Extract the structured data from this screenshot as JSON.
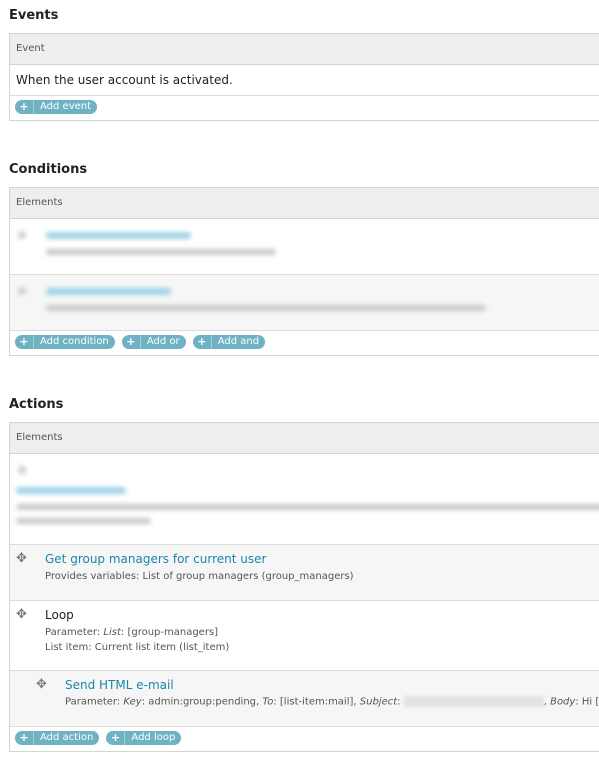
{
  "events": {
    "title": "Events",
    "column_header": "Event",
    "rows": [
      {
        "text": "When the user account is activated."
      }
    ],
    "buttons": [
      {
        "icon": "plus-icon",
        "label": "Add event"
      }
    ]
  },
  "conditions": {
    "title": "Conditions",
    "column_header": "Elements",
    "rows": [
      {
        "blurred": true
      },
      {
        "blurred": true
      }
    ],
    "buttons": [
      {
        "icon": "plus-icon",
        "label": "Add condition"
      },
      {
        "icon": "plus-icon",
        "label": "Add or"
      },
      {
        "icon": "plus-icon",
        "label": "Add and"
      }
    ]
  },
  "actions": {
    "title": "Actions",
    "column_header": "Elements",
    "rows": [
      {
        "blurred": true
      },
      {
        "title": "Get group managers for current user",
        "description": "Provides variables: List of group managers (group_managers)"
      },
      {
        "title": "Loop",
        "param_prefix": "Parameter: ",
        "param_key": "List",
        "param_value": ": [group-managers]",
        "list_item": "List item: Current list item (list_item)"
      },
      {
        "title": "Send HTML e-mail",
        "param_prefix": "Parameter: ",
        "key_label": "Key",
        "key_value": ": admin:group:pending, ",
        "to_label": "To",
        "to_value": ": [list-item:mail], ",
        "subject_label": "Subject",
        "subject_value": ": ",
        "body_sep": ", ",
        "body_label": "Body",
        "body_value": ": Hi [l"
      }
    ],
    "buttons": [
      {
        "icon": "plus-icon",
        "label": "Add action"
      },
      {
        "icon": "plus-icon",
        "label": "Add loop"
      }
    ]
  },
  "icons": {
    "plus": "+",
    "drag": "✥"
  },
  "colors": {
    "button_bg": "#6fb2c4",
    "link": "#1a86ad",
    "header_bg": "#eeeeee"
  }
}
